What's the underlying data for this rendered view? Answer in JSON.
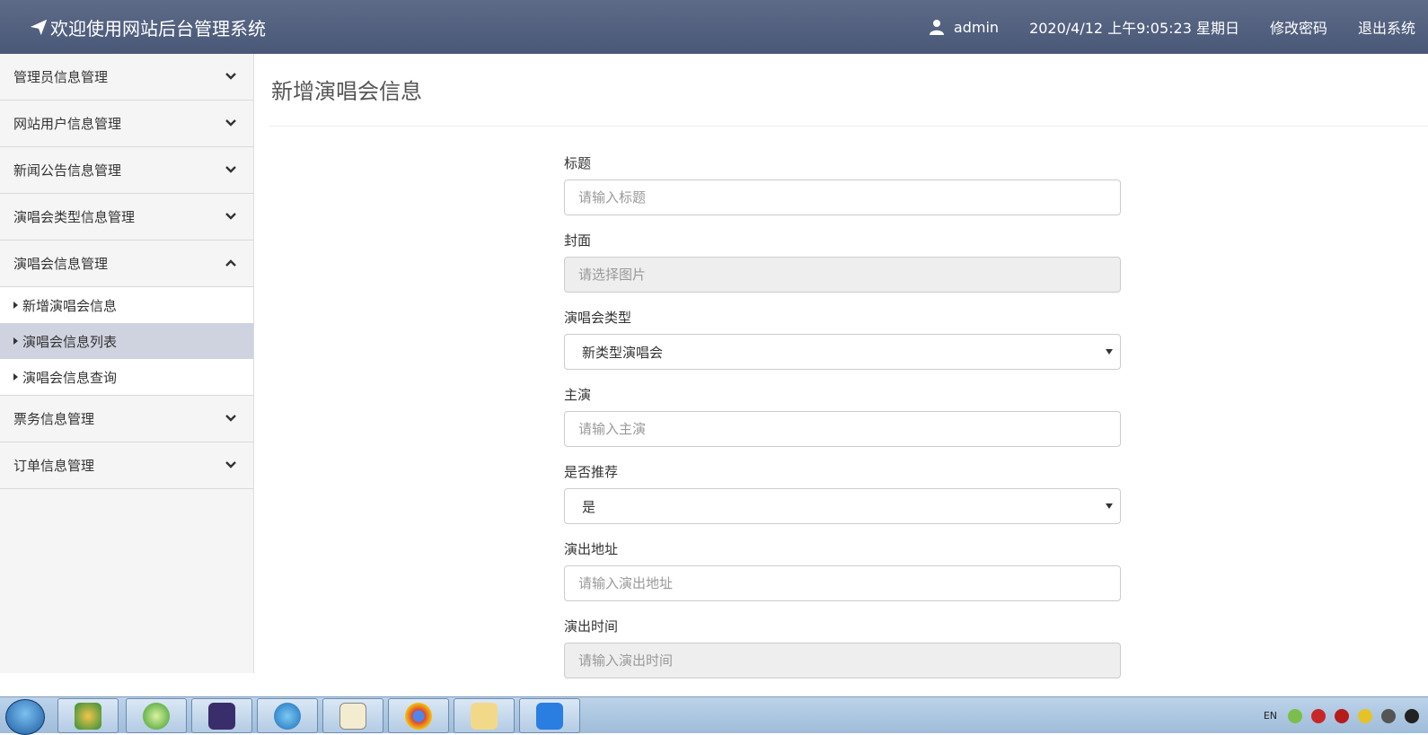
{
  "header": {
    "title": "欢迎使用网站后台管理系统",
    "user": "admin",
    "datetime": "2020/4/12 上午9:05:23 星期日",
    "change_password": "修改密码",
    "logout": "退出系统"
  },
  "sidebar": {
    "menus": [
      {
        "label": "管理员信息管理",
        "icon": "chevron-down-icon"
      },
      {
        "label": "网站用户信息管理",
        "icon": "chevron-down-icon"
      },
      {
        "label": "新闻公告信息管理",
        "icon": "chevron-down-icon"
      },
      {
        "label": "演唱会类型信息管理",
        "icon": "chevron-down-icon"
      },
      {
        "label": "演唱会信息管理",
        "icon": "chevron-up-icon",
        "expanded": true,
        "items": [
          {
            "label": "新增演唱会信息"
          },
          {
            "label": "演唱会信息列表",
            "active": true
          },
          {
            "label": "演唱会信息查询"
          }
        ]
      },
      {
        "label": "票务信息管理",
        "icon": "chevron-down-icon"
      },
      {
        "label": "订单信息管理",
        "icon": "chevron-down-icon"
      }
    ]
  },
  "main": {
    "page_title": "新增演唱会信息",
    "fields": [
      {
        "label": "标题",
        "placeholder": "请输入标题"
      },
      {
        "label": "封面",
        "placeholder": "请选择图片"
      },
      {
        "label": "演唱会类型",
        "value": "新类型演唱会"
      },
      {
        "label": "主演",
        "placeholder": "请输入主演"
      },
      {
        "label": "是否推荐",
        "value": "是"
      },
      {
        "label": "演出地址",
        "placeholder": "请输入演出地址"
      },
      {
        "label": "演出时间",
        "placeholder": "请输入演出时间"
      }
    ]
  },
  "taskbar": {
    "tray_lang": "EN",
    "apps": [
      "user-accounts-icon",
      "refresh-app-icon",
      "java-ee-ide-icon",
      "dolphin-app-icon",
      "notepad-icon",
      "chrome-icon",
      "file-explorer-icon",
      "editor-app-icon"
    ]
  },
  "colors": {
    "header_bg": "#4e5b7a",
    "sidebar_bg": "#f5f5f5",
    "active_item_bg": "#cfd2df",
    "readonly_input_bg": "#eeeeee"
  }
}
